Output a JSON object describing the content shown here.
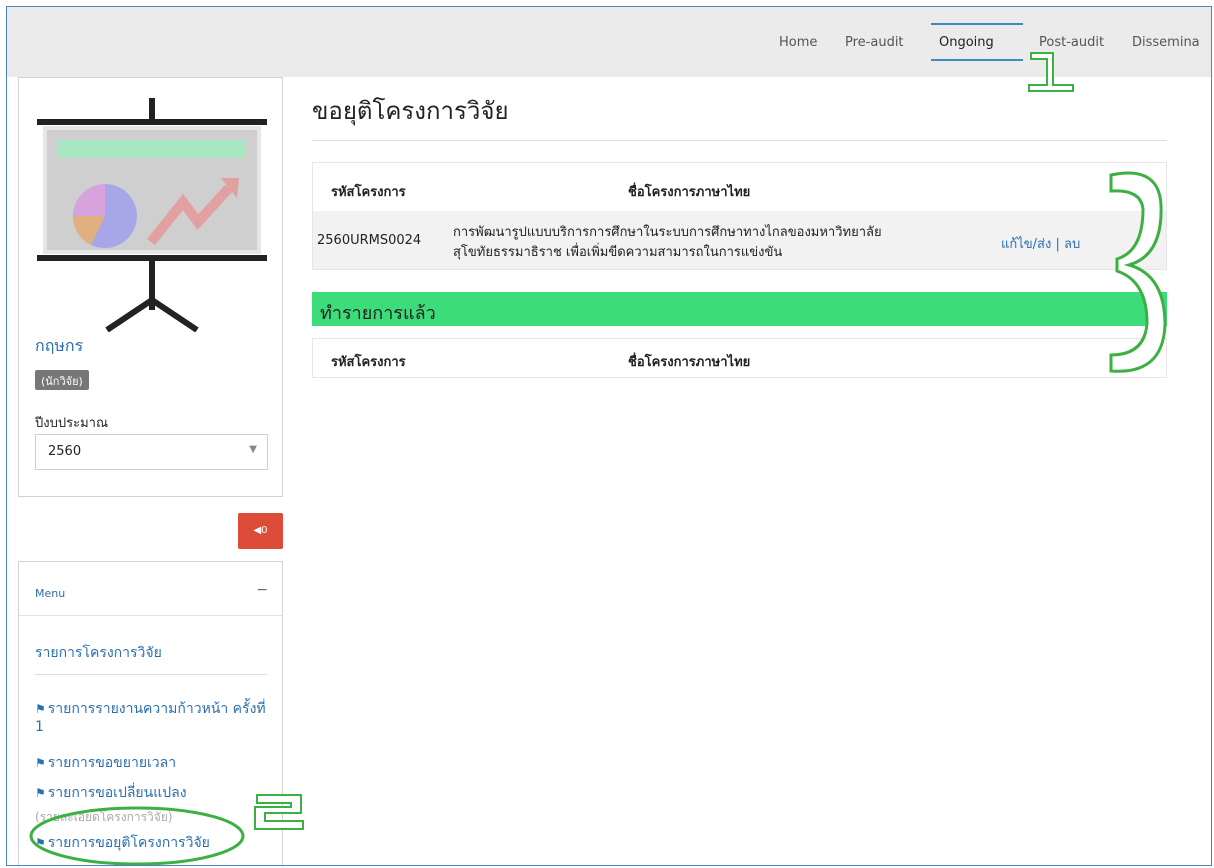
{
  "nav": {
    "items": [
      "Home",
      "Pre-audit",
      "Ongoing",
      "Post-audit",
      "Dissemina"
    ]
  },
  "profile": {
    "name": "กฤษกร",
    "role": "(นักวิจัย)",
    "budget_label": "ปีงบประมาณ",
    "budget_year": "2560"
  },
  "notifications": {
    "count": "0"
  },
  "menu": {
    "title": "Menu",
    "toggle": "−",
    "main_link": "รายการโครงการวิจัย",
    "items": [
      "รายการรายงานความก้าวหน้า ครั้งที่ 1",
      "รายการขอขยายเวลา",
      "รายการขอเปลี่ยนแปลง",
      "รายการขอยุติโครงการวิจัย"
    ],
    "sub_note": "(รายละเอียดโครงการวิจัย)"
  },
  "page": {
    "title": "ขอยุติโครงการวิจัย",
    "table": {
      "col_code": "รหัสโครงการ",
      "col_name": "ชื่อโครงการภาษาไทย",
      "rows": [
        {
          "code": "2560URMS0024",
          "name_line1": "การพัฒนารูปแบบบริการการศึกษาในระบบการศึกษาทางไกลของมหาวิทยาลัย",
          "name_line2": "สุโขทัยธรรมาธิราช เพื่อเพิ่มขีดความสามารถในการแข่งขัน",
          "edit": "แก้ไข/ส่ง",
          "sep": " | ",
          "delete": "ลบ"
        }
      ]
    },
    "done_section": {
      "title": "ทำรายการแล้ว",
      "col_code": "รหัสโครงการ",
      "col_name": "ชื่อโครงการภาษาไทย"
    }
  },
  "annotations": [
    "1",
    "2",
    "3"
  ],
  "colors": {
    "accent": "#3c8dbc",
    "done_bar": "#3ddc7a",
    "notif": "#dd4b39",
    "annotation": "#3cb043"
  }
}
